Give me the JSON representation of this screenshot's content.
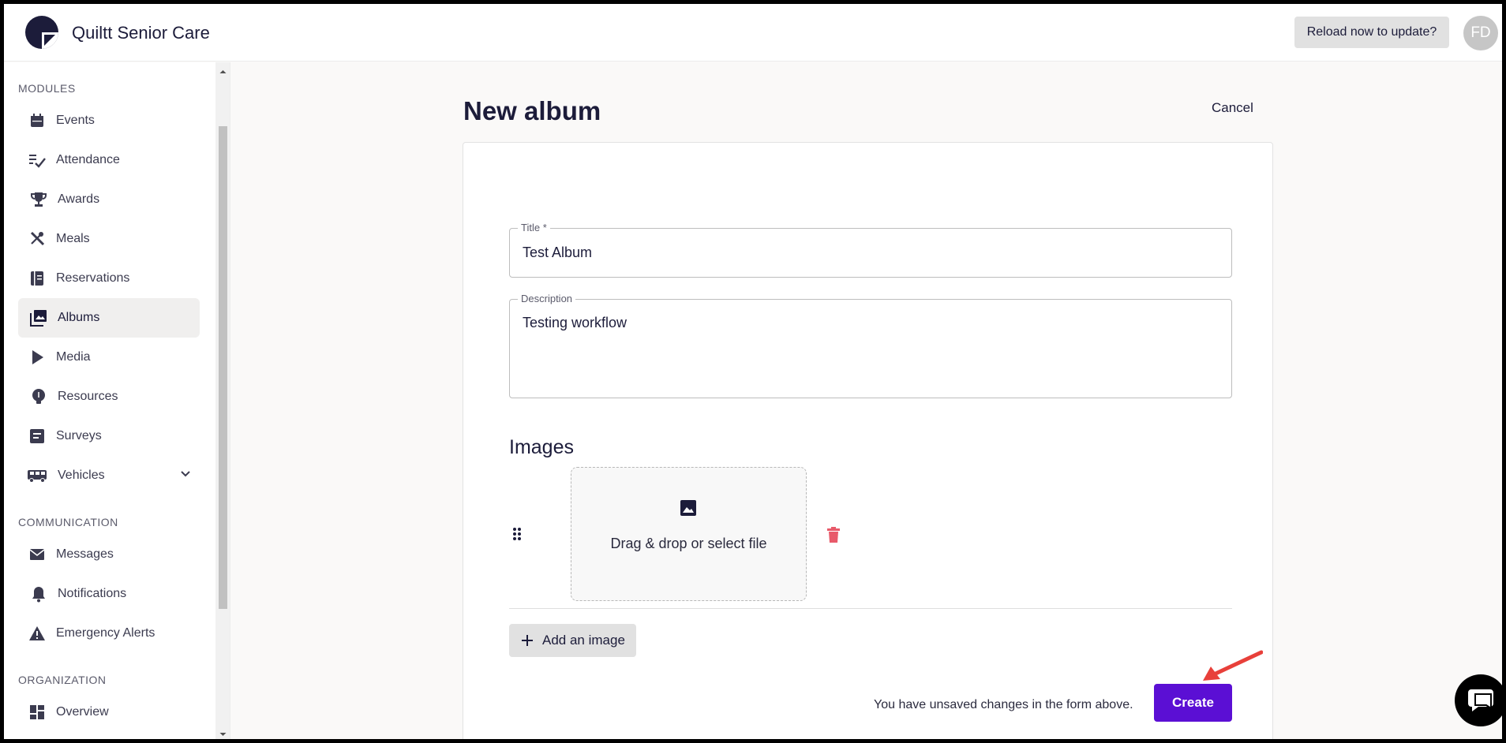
{
  "header": {
    "brand": "Quiltt Senior Care",
    "reload_label": "Reload now to update?",
    "avatar_initials": "FD"
  },
  "sidebar": {
    "sections": {
      "modules": "MODULES",
      "communication": "COMMUNICATION",
      "organization": "ORGANIZATION"
    },
    "items": [
      {
        "label": "Events",
        "icon": "calendar-icon"
      },
      {
        "label": "Attendance",
        "icon": "checklist-icon"
      },
      {
        "label": "Awards",
        "icon": "trophy-icon"
      },
      {
        "label": "Meals",
        "icon": "utensils-icon"
      },
      {
        "label": "Reservations",
        "icon": "book-icon"
      },
      {
        "label": "Albums",
        "icon": "photo-library-icon",
        "active": true
      },
      {
        "label": "Media",
        "icon": "play-icon"
      },
      {
        "label": "Resources",
        "icon": "lightbulb-icon"
      },
      {
        "label": "Surveys",
        "icon": "survey-icon"
      },
      {
        "label": "Vehicles",
        "icon": "bus-icon",
        "expandable": true
      },
      {
        "label": "Messages",
        "icon": "envelope-icon"
      },
      {
        "label": "Notifications",
        "icon": "bell-icon"
      },
      {
        "label": "Emergency Alerts",
        "icon": "warning-icon"
      },
      {
        "label": "Overview",
        "icon": "dashboard-icon"
      }
    ]
  },
  "main": {
    "page_title": "New album",
    "cancel_label": "Cancel",
    "form": {
      "title_label": "Title *",
      "title_value": "Test Album",
      "description_label": "Description",
      "description_value": "Testing workflow",
      "images_heading": "Images",
      "dropzone_text": "Drag & drop or select file",
      "add_image_label": "Add an image",
      "unsaved_message": "You have unsaved changes in the form above.",
      "create_label": "Create"
    }
  },
  "colors": {
    "primary": "#5b0fd4",
    "brand_dark": "#1c1c3a",
    "danger": "#e85a6a",
    "annotation_arrow": "#e8403a"
  }
}
